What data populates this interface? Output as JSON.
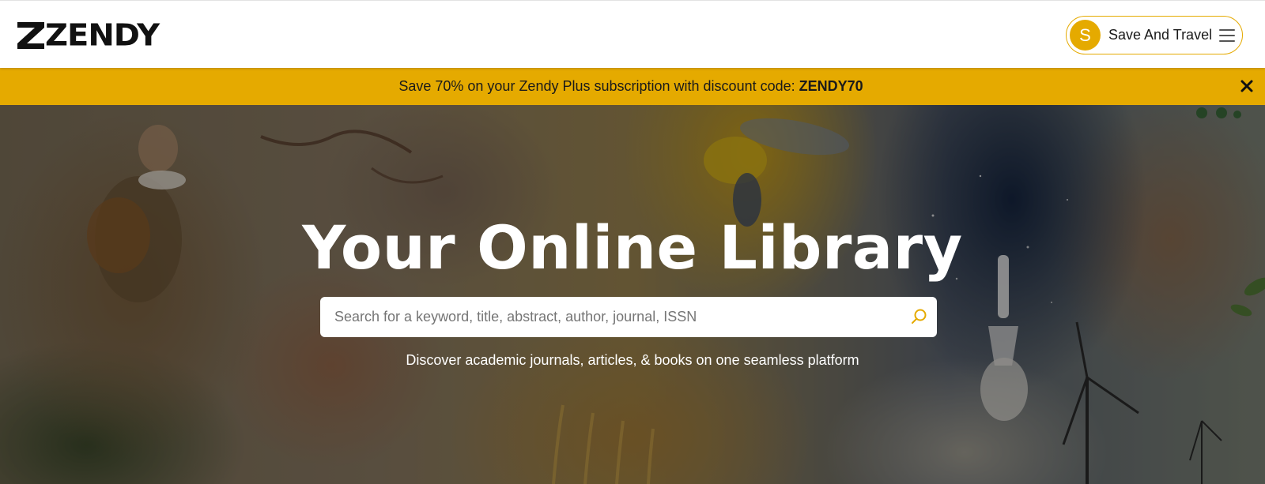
{
  "header": {
    "logo_text": "ZENDY",
    "user": {
      "avatar_initial": "S",
      "name": "Save And Travel"
    },
    "menu_icon": "hamburger-menu-icon"
  },
  "promo": {
    "text": "Save 70% on your Zendy Plus subscription with discount code: ",
    "code": "ZENDY70",
    "close_icon": "close-icon"
  },
  "hero": {
    "title": "Your Online Library",
    "search": {
      "placeholder": "Search for a keyword, title, abstract, author, journal, ISSN",
      "value": "",
      "icon": "search-icon"
    },
    "subtitle": "Discover academic journals, articles, & books on one seamless platform"
  },
  "colors": {
    "accent": "#e5aa00",
    "header_bg": "#ffffff",
    "text_dark": "#1a1a1a"
  }
}
